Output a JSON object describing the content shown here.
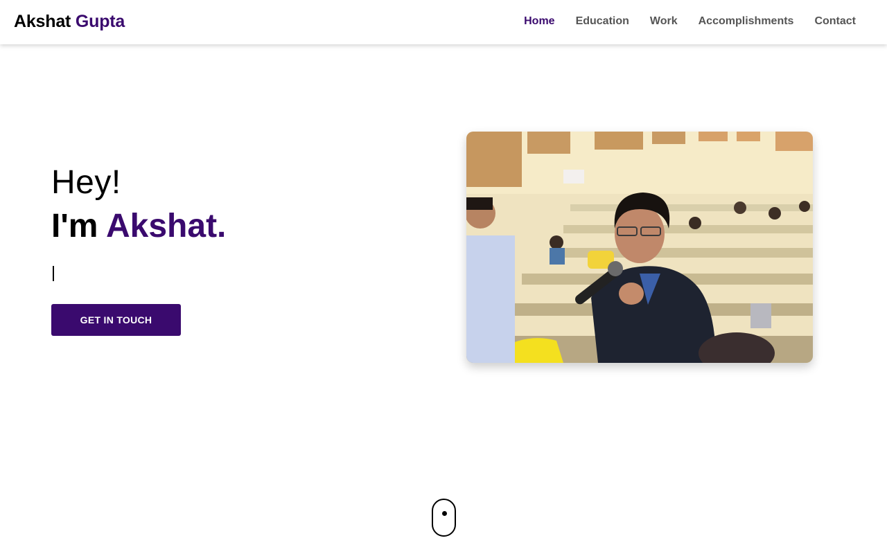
{
  "brand": {
    "first": "Akshat",
    "last": "Gupta",
    "accent_color": "#3a0a6e"
  },
  "nav": {
    "items": [
      {
        "label": "Home",
        "active": true
      },
      {
        "label": "Education",
        "active": false
      },
      {
        "label": "Work",
        "active": false
      },
      {
        "label": "Accomplishments",
        "active": false
      },
      {
        "label": "Contact",
        "active": false
      }
    ]
  },
  "hero": {
    "greeting": "Hey!",
    "intro_prefix": "I'm",
    "intro_name": "Akshat.",
    "typed_text": "",
    "cta_label": "GET IN TOUCH"
  },
  "photo": {
    "icon": "portrait-photo"
  },
  "scroll": {
    "icon": "mouse-scroll-icon"
  },
  "colors": {
    "primary": "#3a0a6e",
    "text": "#000000",
    "nav_text": "#555555",
    "background": "#ffffff"
  }
}
